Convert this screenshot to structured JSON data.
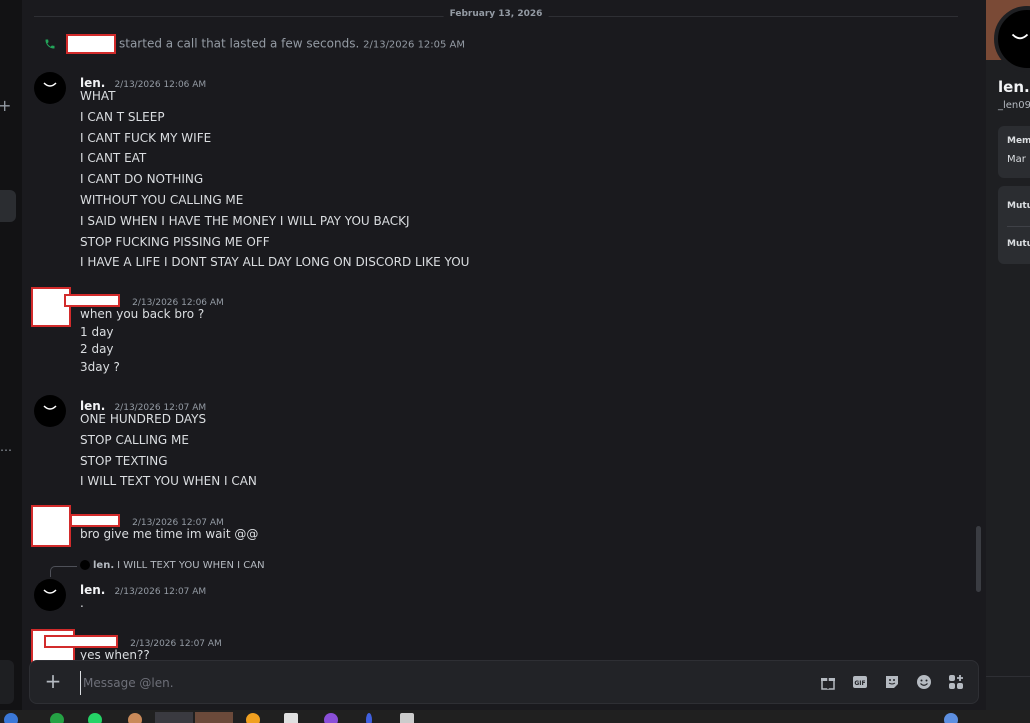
{
  "chat": {
    "date_divider": "February 13, 2026",
    "call_event": {
      "text": "started a call that lasted a few seconds.",
      "timestamp": "2/13/2026 12:05 AM"
    },
    "messages": [
      {
        "author": "len.",
        "timestamp": "2/13/2026 12:06 AM",
        "lines": [
          "WHAT",
          "I CAN T SLEEP",
          "I CANT FUCK MY WIFE",
          "I CANT EAT",
          "I CANT DO NOTHING",
          "WITHOUT YOU CALLING ME",
          "I SAID WHEN I HAVE THE MONEY I WILL PAY YOU BACKJ",
          "STOP FUCKING PISSING ME OFF",
          "I HAVE A LIFE I DONT STAY ALL DAY LONG ON DISCORD LIKE YOU"
        ]
      },
      {
        "author": "",
        "timestamp": "2/13/2026 12:06 AM",
        "lines": [
          "when you back bro ?",
          "1 day",
          "2 day",
          "3day ?"
        ]
      },
      {
        "author": "len.",
        "timestamp": "2/13/2026 12:07 AM",
        "lines": [
          "ONE HUNDRED DAYS",
          "STOP CALLING ME",
          "STOP TEXTING",
          "I WILL TEXT YOU WHEN I CAN"
        ]
      },
      {
        "author": "",
        "timestamp": "2/13/2026 12:07 AM",
        "lines": [
          "bro give me time im wait  @@"
        ]
      },
      {
        "author": "len.",
        "timestamp": "2/13/2026 12:07 AM",
        "reply_author": "len.",
        "reply_text": "I WILL TEXT YOU WHEN I CAN",
        "lines": [
          "."
        ]
      },
      {
        "author": "",
        "timestamp": "2/13/2026 12:07 AM",
        "lines": [
          "yes when??"
        ]
      }
    ]
  },
  "composer": {
    "placeholder": "Message @len."
  },
  "profile": {
    "name": "len.",
    "username": "_len09",
    "member_since_label": "Mem",
    "member_since_value": "Mar",
    "mutual_servers_label": "Mutu",
    "mutual_friends_label": "Mutu"
  },
  "icons": {
    "call": "phone-icon",
    "add": "plus-icon",
    "gift": "gift-icon",
    "gif": "gif-icon",
    "sticker": "sticker-icon",
    "emoji": "emoji-icon",
    "apps": "apps-icon"
  },
  "colors": {
    "background": "#1a1a1e",
    "call_green": "#23a55a",
    "redaction_border": "#d22b2b"
  }
}
